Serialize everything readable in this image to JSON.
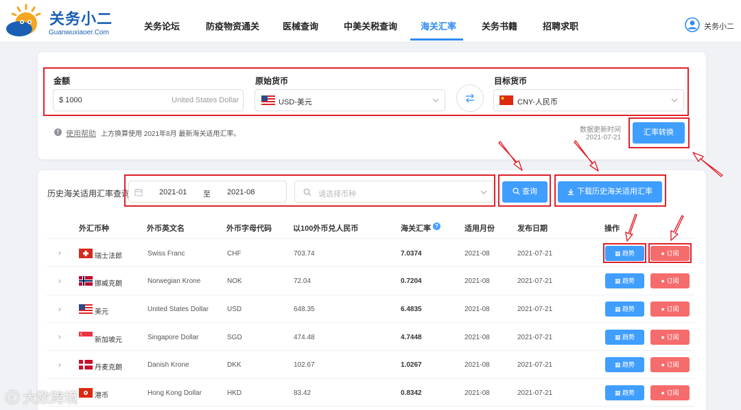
{
  "brand": {
    "name": "关务小二",
    "domain": "Guanwuxiaoer.Com"
  },
  "nav": {
    "items": [
      "关务论坛",
      "防疫物资通关",
      "医械查询",
      "中美关税查询",
      "海关汇率",
      "关务书籍",
      "招聘求职"
    ],
    "active": "海关汇率",
    "user": "关务小二"
  },
  "converter": {
    "amount_label": "金额",
    "amount_value": "$ 1000",
    "amount_unit": "United States Dollar",
    "from_label": "原始货币",
    "from_value": "USD-美元",
    "to_label": "目标货币",
    "to_value": "CNY-人民币",
    "help_link": "使用帮助",
    "help_note": "上方换算使用 2021年8月 最新海关适用汇率。",
    "update_label": "数据更新时间",
    "update_date": "2021-07-21",
    "convert_button": "汇率转换"
  },
  "history": {
    "label": "历史海关适用汇率查询",
    "date_start": "2021-01",
    "date_sep": "至",
    "date_end": "2021-08",
    "currency_placeholder": "请选择币种",
    "query_button": "查询",
    "download_button": "下载历史海关适用汇率"
  },
  "table": {
    "headers": [
      "外汇币种",
      "外币英文名",
      "外币字母代码",
      "以100外币兑人民币",
      "海关汇率",
      "适用月份",
      "发布日期",
      "操作"
    ],
    "trend_label": "趋势",
    "subscribe_label": "订阅",
    "rows": [
      {
        "cn": "瑞士法郎",
        "en": "Swiss Franc",
        "code": "CHF",
        "per100": "703.74",
        "rate": "7.0374",
        "month": "2021-08",
        "date": "2021-07-21"
      },
      {
        "cn": "挪威克朗",
        "en": "Norwegian Krone",
        "code": "NOK",
        "per100": "72.04",
        "rate": "0.7204",
        "month": "2021-08",
        "date": "2021-07-21"
      },
      {
        "cn": "美元",
        "en": "United States Dollar",
        "code": "USD",
        "per100": "648.35",
        "rate": "6.4835",
        "month": "2021-08",
        "date": "2021-07-21"
      },
      {
        "cn": "新加坡元",
        "en": "Singapore Dollar",
        "code": "SGD",
        "per100": "474.48",
        "rate": "4.7448",
        "month": "2021-08",
        "date": "2021-07-21"
      },
      {
        "cn": "丹麦克朗",
        "en": "Danish Krone",
        "code": "DKK",
        "per100": "102.67",
        "rate": "1.0267",
        "month": "2021-08",
        "date": "2021-07-21"
      },
      {
        "cn": "港币",
        "en": "Hong Kong Dollar",
        "code": "HKD",
        "per100": "83.42",
        "rate": "0.8342",
        "month": "2021-08",
        "date": "2021-07-21"
      }
    ]
  },
  "watermark": "大数跨境",
  "colors": {
    "accent": "#2d8cf0",
    "button_blue": "#409eff",
    "button_red": "#f56c6c",
    "annotation_red": "#e0202a"
  }
}
